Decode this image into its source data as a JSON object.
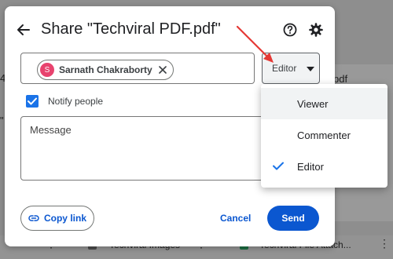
{
  "background": {
    "partial_right_text": "pdf",
    "partial_left_text_1": "4",
    "partial_left_text_2": "\"",
    "file_1_name": "Techviral Images",
    "file_2_name": "Techviral File Attach..."
  },
  "dialog": {
    "title": "Share \"Techviral PDF.pdf\"",
    "back_icon": "arrow-left-icon",
    "help_icon": "help-circle-icon",
    "settings_icon": "gear-icon"
  },
  "recipient": {
    "initial": "S",
    "name": "Sarnath Chakraborty",
    "avatar_color": "#e8436e"
  },
  "role_select": {
    "selected": "Editor"
  },
  "notify": {
    "label": "Notify people",
    "checked": true
  },
  "message": {
    "placeholder": "Message",
    "value": ""
  },
  "footer": {
    "copy_link_label": "Copy link",
    "cancel_label": "Cancel",
    "send_label": "Send"
  },
  "role_menu": {
    "items": [
      {
        "label": "Viewer",
        "selected": false,
        "highlighted": true
      },
      {
        "label": "Commenter",
        "selected": false,
        "highlighted": false
      },
      {
        "label": "Editor",
        "selected": true,
        "highlighted": false
      }
    ]
  },
  "colors": {
    "primary_blue": "#0b57d0",
    "checkbox_blue": "#1a73e8",
    "annotation_red": "#e53935"
  }
}
